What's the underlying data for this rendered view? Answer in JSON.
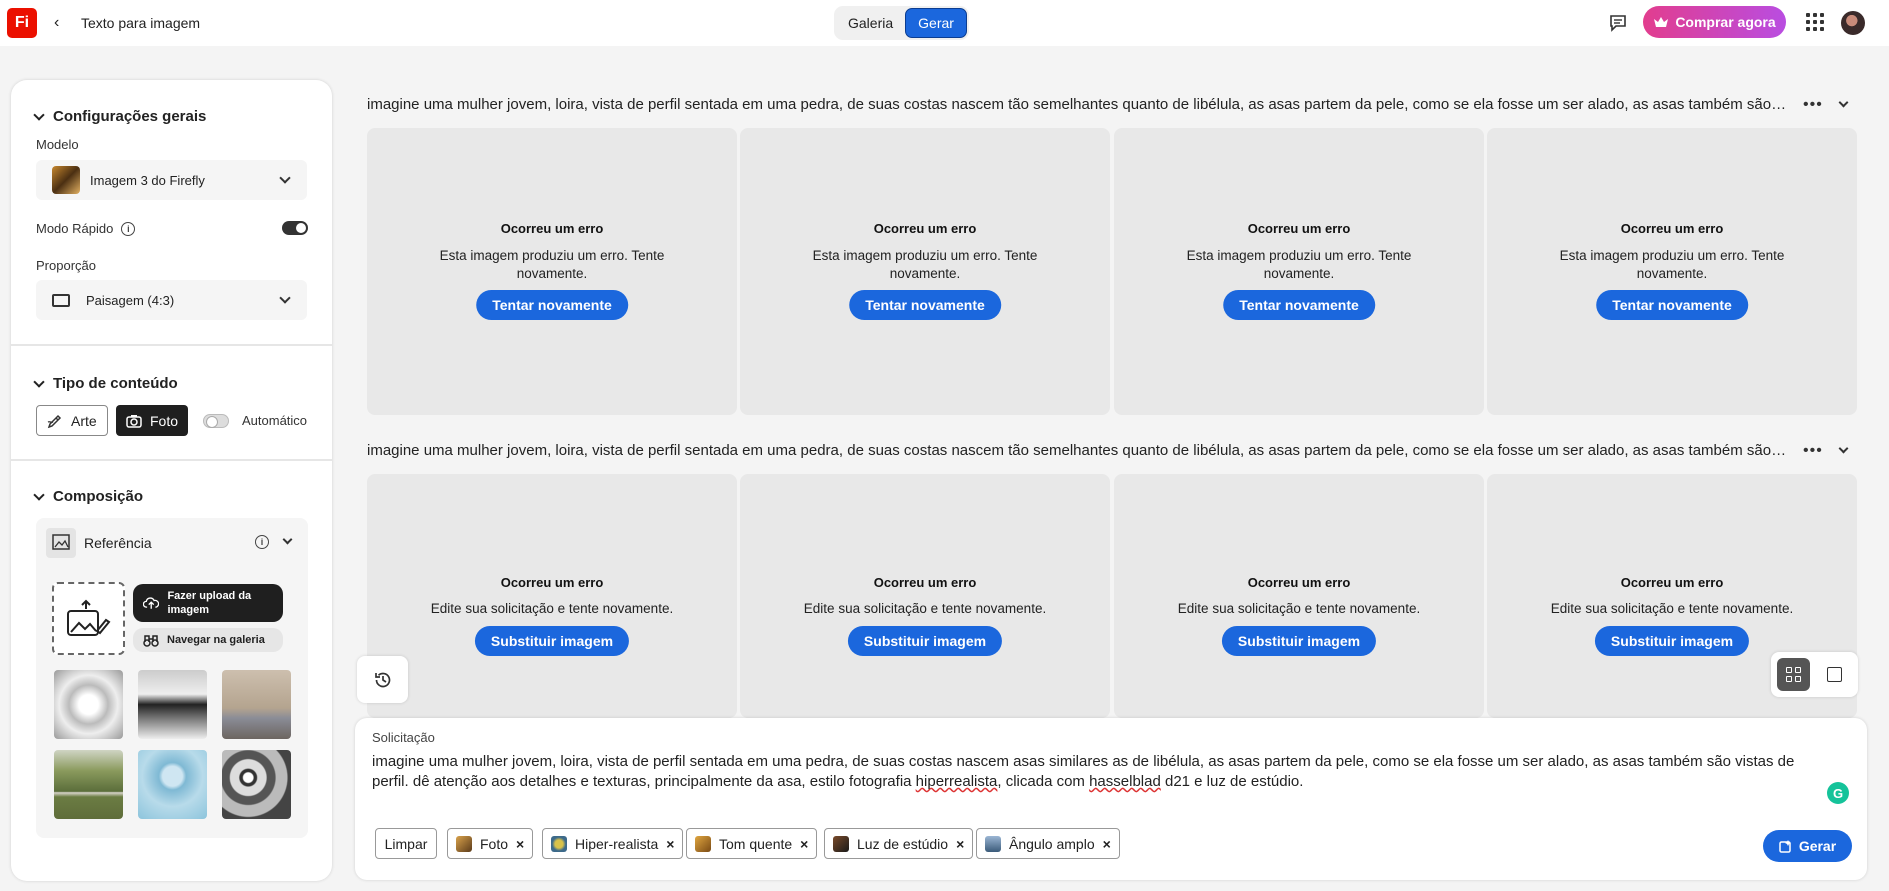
{
  "topbar": {
    "logo_text": "Fi",
    "back_label": "Texto para imagem",
    "tabs": [
      {
        "label": "Galeria",
        "active": false
      },
      {
        "label": "Gerar",
        "active": true
      }
    ],
    "buy_label": "Comprar agora"
  },
  "sidebar": {
    "general": {
      "title": "Configurações gerais",
      "model_label": "Modelo",
      "model_value": "Imagem 3 do Firefly",
      "fast_mode_label": "Modo Rápido",
      "fast_mode_on": true,
      "ratio_label": "Proporção",
      "ratio_value": "Paisagem (4:3)"
    },
    "content_type": {
      "title": "Tipo de conteúdo",
      "art_label": "Arte",
      "photo_label": "Foto",
      "auto_label": "Automático",
      "selected": "Foto",
      "auto_on": false
    },
    "composition": {
      "title": "Composição",
      "reference_label": "Referência",
      "upload_label": "Fazer upload da imagem",
      "gallery_label": "Navegar na galeria"
    }
  },
  "main": {
    "rows": [
      {
        "prompt": "imagine uma mulher jovem, loira, vista de perfil sentada em uma pedra, de suas costas nascem tão semelhantes quanto de libélula, as asas partem da pele, como se ela fosse um ser alado, as asas também são vistas de ...",
        "cards": [
          {
            "title": "Ocorreu um erro",
            "desc": "Esta imagem produziu um erro. Tente novamente.",
            "button": "Tentar novamente"
          },
          {
            "title": "Ocorreu um erro",
            "desc": "Esta imagem produziu um erro. Tente novamente.",
            "button": "Tentar novamente"
          },
          {
            "title": "Ocorreu um erro",
            "desc": "Esta imagem produziu um erro. Tente novamente.",
            "button": "Tentar novamente"
          },
          {
            "title": "Ocorreu um erro",
            "desc": "Esta imagem produziu um erro. Tente novamente.",
            "button": "Tentar novamente"
          }
        ]
      },
      {
        "prompt": "imagine uma mulher jovem, loira, vista de perfil sentada em uma pedra, de suas costas nascem tão semelhantes quanto de libélula, as asas partem da pele, como se ela fosse um ser alado, as asas também são vistas de ...",
        "cards": [
          {
            "title": "Ocorreu um erro",
            "desc": "Edite sua solicitação e tente novamente.",
            "button": "Substituir imagem"
          },
          {
            "title": "Ocorreu um erro",
            "desc": "Edite sua solicitação e tente novamente.",
            "button": "Substituir imagem"
          },
          {
            "title": "Ocorreu um erro",
            "desc": "Edite sua solicitação e tente novamente.",
            "button": "Substituir imagem"
          },
          {
            "title": "Ocorreu um erro",
            "desc": "Edite sua solicitação e tente novamente.",
            "button": "Substituir imagem"
          }
        ]
      }
    ]
  },
  "prompt_panel": {
    "label": "Solicitação",
    "text_part1": "imagine uma mulher jovem, loira, vista de perfil sentada em uma pedra, de suas costas nascem asas similares as de libélula, as asas partem da pele, como se ela fosse um ser alado, as asas também são vistas de perfil. dê atenção aos detalhes e texturas, principalmente da asa, estilo fotografia ",
    "text_word1": "hiperrealista",
    "text_part2": ", clicada com ",
    "text_word2": "hasselblad",
    "text_part3": " d21 e luz de estúdio.",
    "grammarly_label": "G",
    "clear_label": "Limpar",
    "chips": [
      "Foto",
      "Hiper-realista",
      "Tom quente",
      "Luz de estúdio",
      "Ângulo amplo"
    ],
    "generate_label": "Gerar"
  },
  "colors": {
    "accent": "#1b67dd",
    "logo": "#eb1000",
    "buy_gradient_start": "#e23d8e",
    "buy_gradient_end": "#b94de1"
  }
}
